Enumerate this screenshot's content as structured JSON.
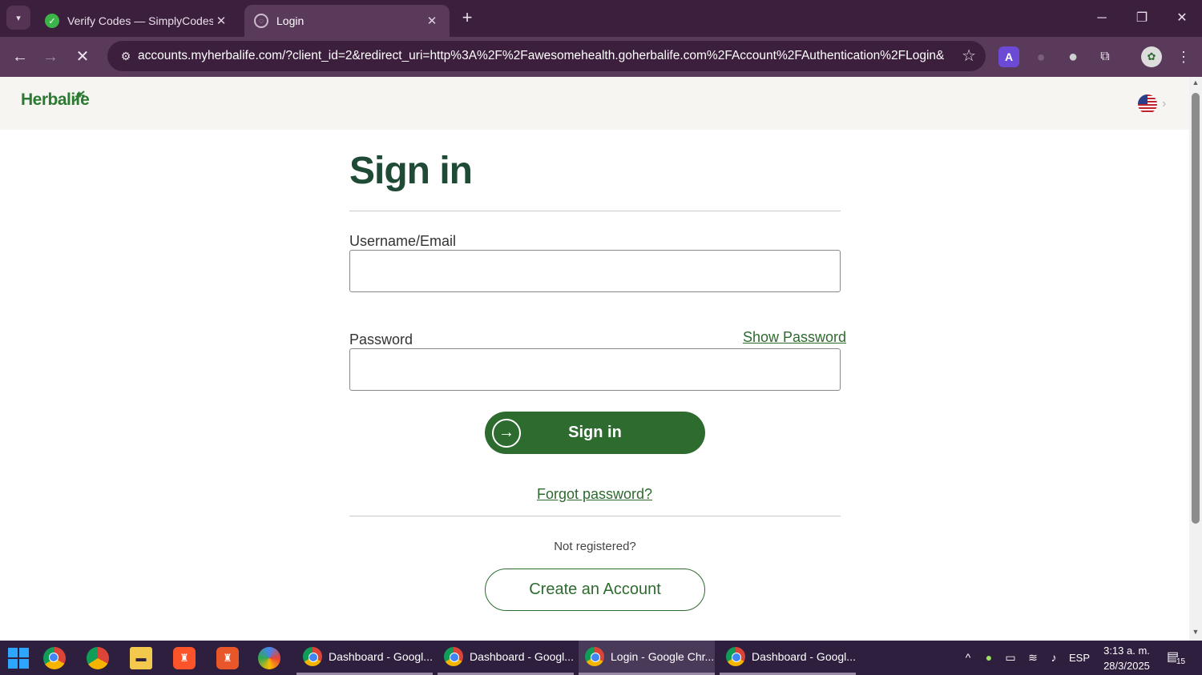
{
  "browser": {
    "tabs": [
      {
        "title": "Verify Codes — SimplyCodes",
        "favicon": "simplycodes-icon",
        "active": false
      },
      {
        "title": "Login",
        "favicon": "loading-icon",
        "active": true
      }
    ],
    "new_tab": "+",
    "url": "accounts.myherbalife.com/?client_id=2&redirect_uri=http%3A%2F%2Fawesomehealth.goherbalife.com%2FAccount%2FAuthentication%2FLogin&r...",
    "profile_letter": "A"
  },
  "page": {
    "logo_text": "Herbalife",
    "title": "Sign in",
    "username_label": "Username/Email",
    "username_value": "",
    "password_label": "Password",
    "password_value": "",
    "show_password": "Show Password",
    "signin_button": "Sign in",
    "forgot_password": "Forgot password?",
    "not_registered": "Not registered?",
    "create_account": "Create an Account"
  },
  "taskbar": {
    "tasks": [
      {
        "title": "Dashboard - Googl...",
        "active": false
      },
      {
        "title": "Dashboard - Googl...",
        "active": false
      },
      {
        "title": "Login - Google Chr...",
        "active": true
      },
      {
        "title": "Dashboard - Googl...",
        "active": false
      }
    ],
    "language": "ESP",
    "time": "3:13 a. m.",
    "date": "28/3/2025",
    "notifications": "15"
  },
  "colors": {
    "brand_green": "#2d6b2f",
    "title_green": "#1f4a35",
    "chrome_frame": "#3c1f3c"
  }
}
